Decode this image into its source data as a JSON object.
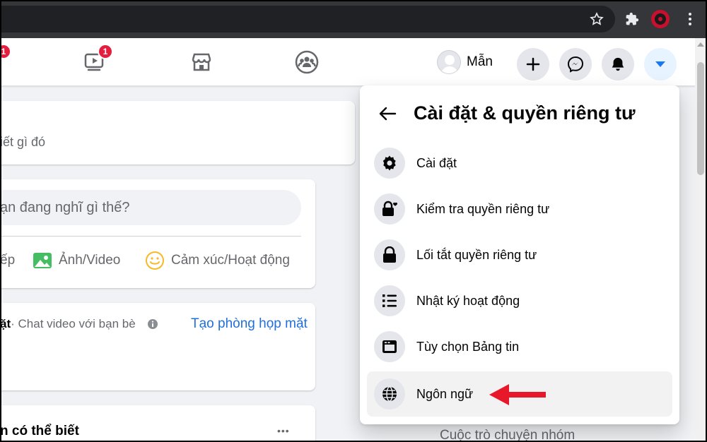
{
  "header": {
    "badges": {
      "leftmost": "1",
      "watch": "1"
    },
    "profile_name": "Mẫn"
  },
  "feed": {
    "card1_text": "iết gì đó",
    "composer_placeholder": "ạn đang nghĩ gì thế?",
    "action_live": "ếp",
    "action_photo": "Ảnh/Video",
    "action_feeling": "Cảm xúc/Hoạt động",
    "room_prefix": "ặt",
    "room_desc": " · Chat video với bạn bè",
    "room_link": "Tạo phòng họp mặt",
    "people_title": "n có thể biết",
    "people_more": "•••"
  },
  "dropdown": {
    "title": "Cài đặt & quyền riêng tư",
    "items": [
      {
        "label": "Cài đặt",
        "icon": "gear-icon"
      },
      {
        "label": "Kiểm tra quyền riêng tư",
        "icon": "lock-heart-icon"
      },
      {
        "label": "Lối tắt quyền riêng tư",
        "icon": "lock-icon"
      },
      {
        "label": "Nhật ký hoạt động",
        "icon": "list-icon"
      },
      {
        "label": "Tùy chọn Bảng tin",
        "icon": "feed-icon"
      },
      {
        "label": "Ngôn ngữ",
        "icon": "globe-icon"
      }
    ]
  },
  "sidebar": {
    "group_chats": "Cuộc trò chuyện nhóm"
  },
  "colors": {
    "accent": "#1877f2",
    "badge": "#e41e3f",
    "annotation_arrow": "#e8182b"
  }
}
